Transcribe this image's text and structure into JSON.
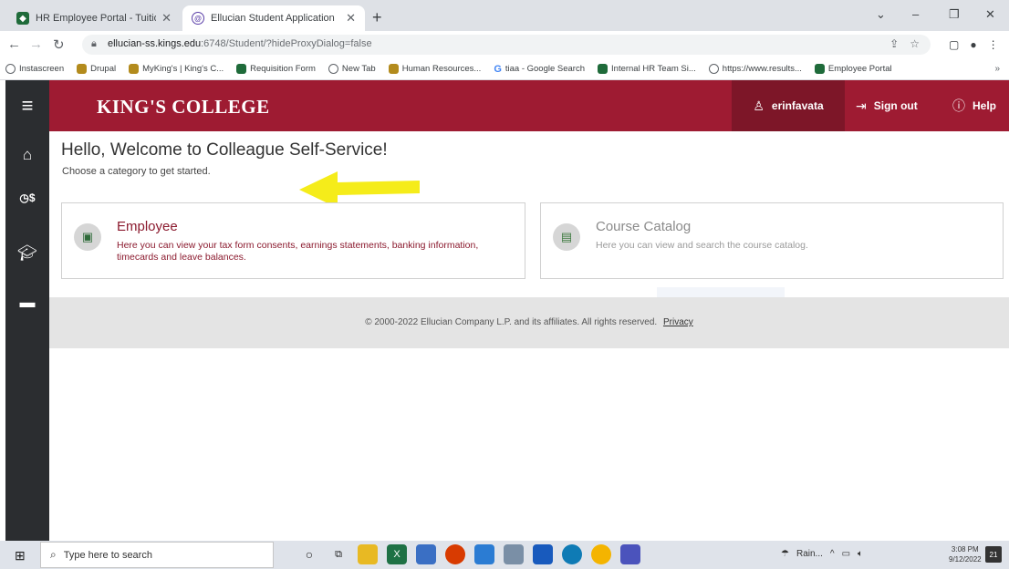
{
  "browser": {
    "tabs": [
      {
        "title": "HR Employee Portal - Tuition Exc",
        "icon": "hr-portal-icon"
      },
      {
        "title": "Ellucian Student Application",
        "icon": "ellucian-icon"
      }
    ],
    "url_host": "ellucian-ss.kings.edu",
    "url_rest": ":6748/Student/?hideProxyDialog=false",
    "bookmarks": [
      {
        "label": "Instascreen",
        "icon": "globe"
      },
      {
        "label": "Drupal",
        "icon": "shield"
      },
      {
        "label": "MyKing's | King's C...",
        "icon": "shield"
      },
      {
        "label": "Requisition Form",
        "icon": "hr"
      },
      {
        "label": "New Tab",
        "icon": "globe"
      },
      {
        "label": "Human Resources...",
        "icon": "shield"
      },
      {
        "label": "tiaa - Google Search",
        "icon": "g"
      },
      {
        "label": "Internal HR Team Si...",
        "icon": "hr"
      },
      {
        "label": "https://www.results...",
        "icon": "globe"
      },
      {
        "label": "Employee Portal",
        "icon": "hr"
      }
    ]
  },
  "header": {
    "brand": "KING'S COLLEGE",
    "user": "erinfavata",
    "sign_out": "Sign out",
    "help": "Help",
    "accent": "#9e1b32"
  },
  "main": {
    "title": "Hello, Welcome to Colleague Self-Service!",
    "subtitle": "Choose a category to get started.",
    "cards": {
      "employee": {
        "title": "Employee",
        "description": "Here you can view your tax form consents, earnings statements, banking information, timecards and leave balances."
      },
      "catalog": {
        "title": "Course Catalog",
        "description": "Here you can view and search the course catalog."
      }
    }
  },
  "footer": {
    "copyright": "© 2000-2022 Ellucian Company L.P. and its affiliates. All rights reserved.",
    "privacy": "Privacy"
  },
  "taskbar": {
    "search_placeholder": "Type here to search",
    "weather": "Rain...",
    "time": "3:08 PM",
    "date": "9/12/2022",
    "notifications": "21"
  }
}
